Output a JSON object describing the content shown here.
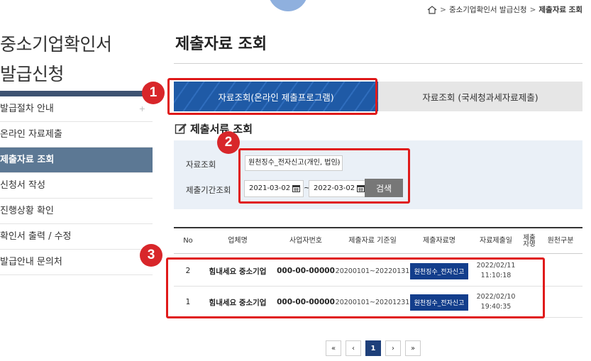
{
  "breadcrumb": {
    "items": [
      "중소기업확인서 발급신청",
      "제출자료 조회"
    ],
    "sep": ">"
  },
  "sidebar": {
    "title_line1": "중소기업확인서",
    "title_line2": "발급신청",
    "items": [
      {
        "label": "발급절차 안내",
        "plus": "+"
      },
      {
        "label": "온라인 자료제출"
      },
      {
        "label": "제출자료 조회",
        "active": true
      },
      {
        "label": "신청서 작성"
      },
      {
        "label": "진행상황 확인"
      },
      {
        "label": "확인서 출력 / 수정"
      },
      {
        "label": "발급안내 문의처"
      }
    ]
  },
  "main": {
    "title": "제출자료 조회",
    "tabs": [
      {
        "label": "자료조회(온라인 제출프로그램)",
        "active": true
      },
      {
        "label": "자료조회 (국세청과세자료제출)"
      }
    ],
    "section_title": "제출서류 조회",
    "search": {
      "type_label": "자료조회",
      "type_value": "원천징수_전자신고(개인, 법인)",
      "period_label": "제출기간조회",
      "date_from": "2021-03-02",
      "date_to": "2022-03-02",
      "tilde": "~",
      "button": "검색"
    },
    "table": {
      "headers": [
        "No",
        "업체명",
        "사업자번호",
        "제출자료 기준일",
        "제출자료명",
        "자료제출일",
        "제출자명",
        "원천구분"
      ],
      "rows": [
        {
          "no": "2",
          "company": "힘내세요 중소기업",
          "bizno": "000-00-00000",
          "period": "20200101~20220131",
          "doc": "원천징수_전자신고",
          "date": "2022/02/11",
          "time": "11:10:18"
        },
        {
          "no": "1",
          "company": "힘내세요 중소기업",
          "bizno": "000-00-00000",
          "period": "20200101~20201231",
          "doc": "원천징수_전자신고",
          "date": "2022/02/10",
          "time": "19:40:35"
        }
      ]
    },
    "pager": {
      "first": "«",
      "prev": "‹",
      "current": "1",
      "next": "›",
      "last": "»"
    }
  },
  "annotations": {
    "badge1": "1",
    "badge2": "2",
    "badge3": "3"
  },
  "colors": {
    "accent_red": "#e01a1a",
    "tab_blue": "#1f5aa6",
    "sidebar_active": "#5c7894",
    "search_bg": "#eaf0f7",
    "doc_btn": "#133e8c"
  },
  "icons": [
    "home-icon",
    "edit-icon",
    "calendar-icon",
    "chevron-down-icon"
  ]
}
